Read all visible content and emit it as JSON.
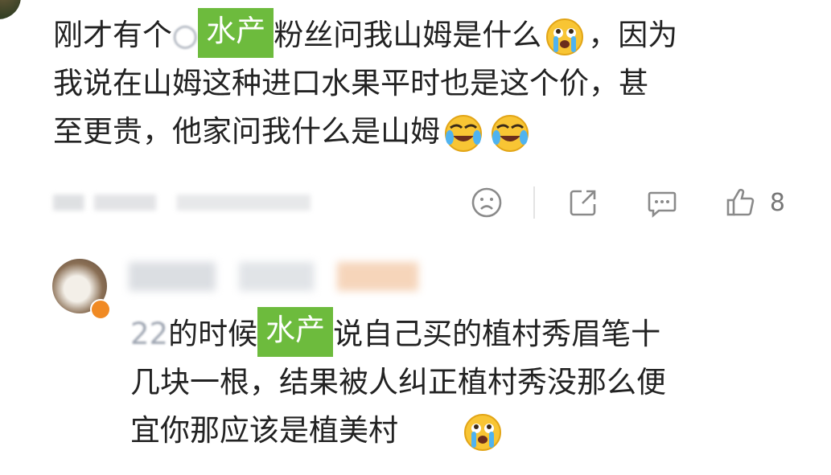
{
  "comment_1": {
    "line_1": {
      "before": "刚才有个",
      "partial_blur": "○",
      "sticker": "水产",
      "after": "粉丝问我山姆是什么",
      "end": "，因为"
    },
    "line_2": "我说在山姆这种进口水果平时也是这个价，甚",
    "line_3": "至更贵，他家问我什么是山姆",
    "like_count": "8"
  },
  "comment_2": {
    "line_1": {
      "partial_blur": "22",
      "before": "的时候",
      "sticker": "水产",
      "after": "说自己买的植村秀眉笔十"
    },
    "line_2": "几块一根，结果被人纠正植村秀没那么便",
    "line_3": "宜你那应该是植美村"
  },
  "icons": {
    "emoji_1": "crying-emoji-icon",
    "emoji_2": "laughing-cry-emoji-icon",
    "dislike": "sad-face-icon",
    "share": "share-icon",
    "reply": "comment-icon",
    "like": "thumbs-up-icon"
  },
  "colors": {
    "sticker_green": "#6dbb3d",
    "text": "#222222",
    "action_grey": "#777777"
  }
}
